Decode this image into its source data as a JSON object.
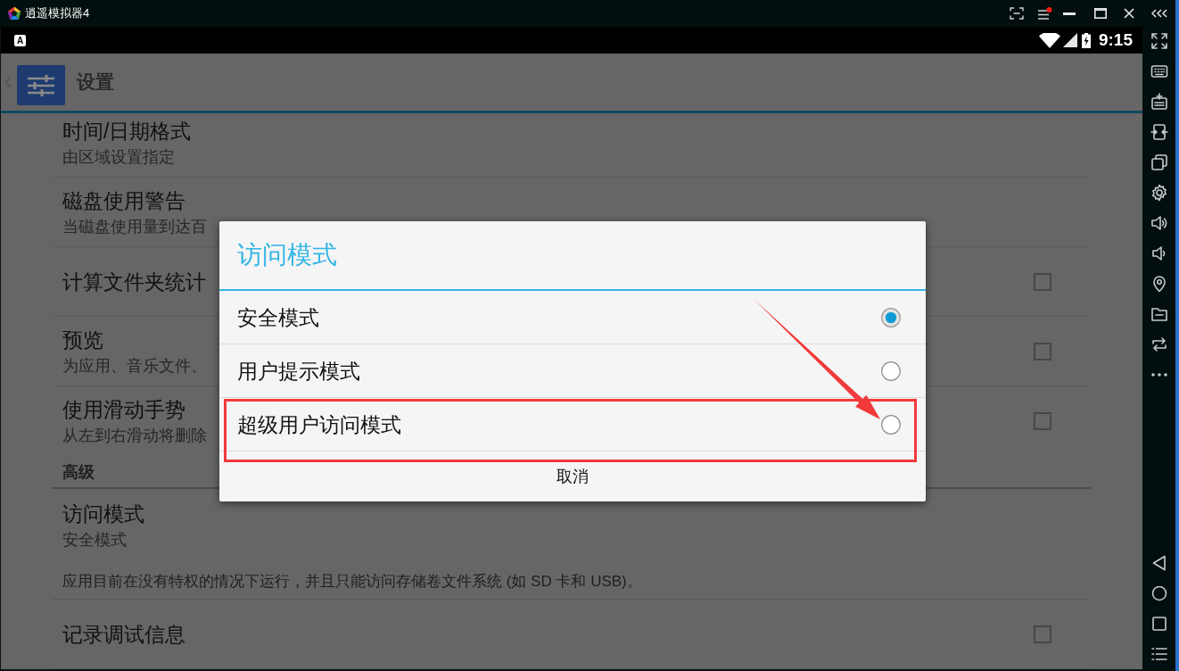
{
  "window": {
    "title": "逍遥模拟器4"
  },
  "status_bar": {
    "notification": "A",
    "time": "9:15"
  },
  "app_bar": {
    "title": "设置"
  },
  "settings": [
    {
      "kind": "item",
      "title": "时间/日期格式",
      "summary": "由区域设置指定"
    },
    {
      "kind": "item",
      "title": "磁盘使用警告",
      "summary": "当磁盘使用量到达百"
    },
    {
      "kind": "checkbox",
      "title": "计算文件夹统计",
      "checked": false
    },
    {
      "kind": "checkbox",
      "title": "预览",
      "summary": "为应用、音乐文件、",
      "checked": false
    },
    {
      "kind": "checkbox",
      "title": "使用滑动手势",
      "summary": "从左到右滑动将删除",
      "checked": false
    },
    {
      "kind": "category",
      "title": "高级"
    },
    {
      "kind": "item",
      "title": "访问模式",
      "summary": "安全模式",
      "description": "应用目前在没有特权的情况下运行，并且只能访问存储卷文件系统 (如 SD 卡和 USB)。"
    },
    {
      "kind": "checkbox",
      "title": "记录调试信息",
      "checked": false
    }
  ],
  "dialog": {
    "title": "访问模式",
    "options": [
      {
        "label": "安全模式",
        "selected": true
      },
      {
        "label": "用户提示模式",
        "selected": false
      },
      {
        "label": "超级用户访问模式",
        "selected": false
      }
    ],
    "cancel": "取消"
  }
}
